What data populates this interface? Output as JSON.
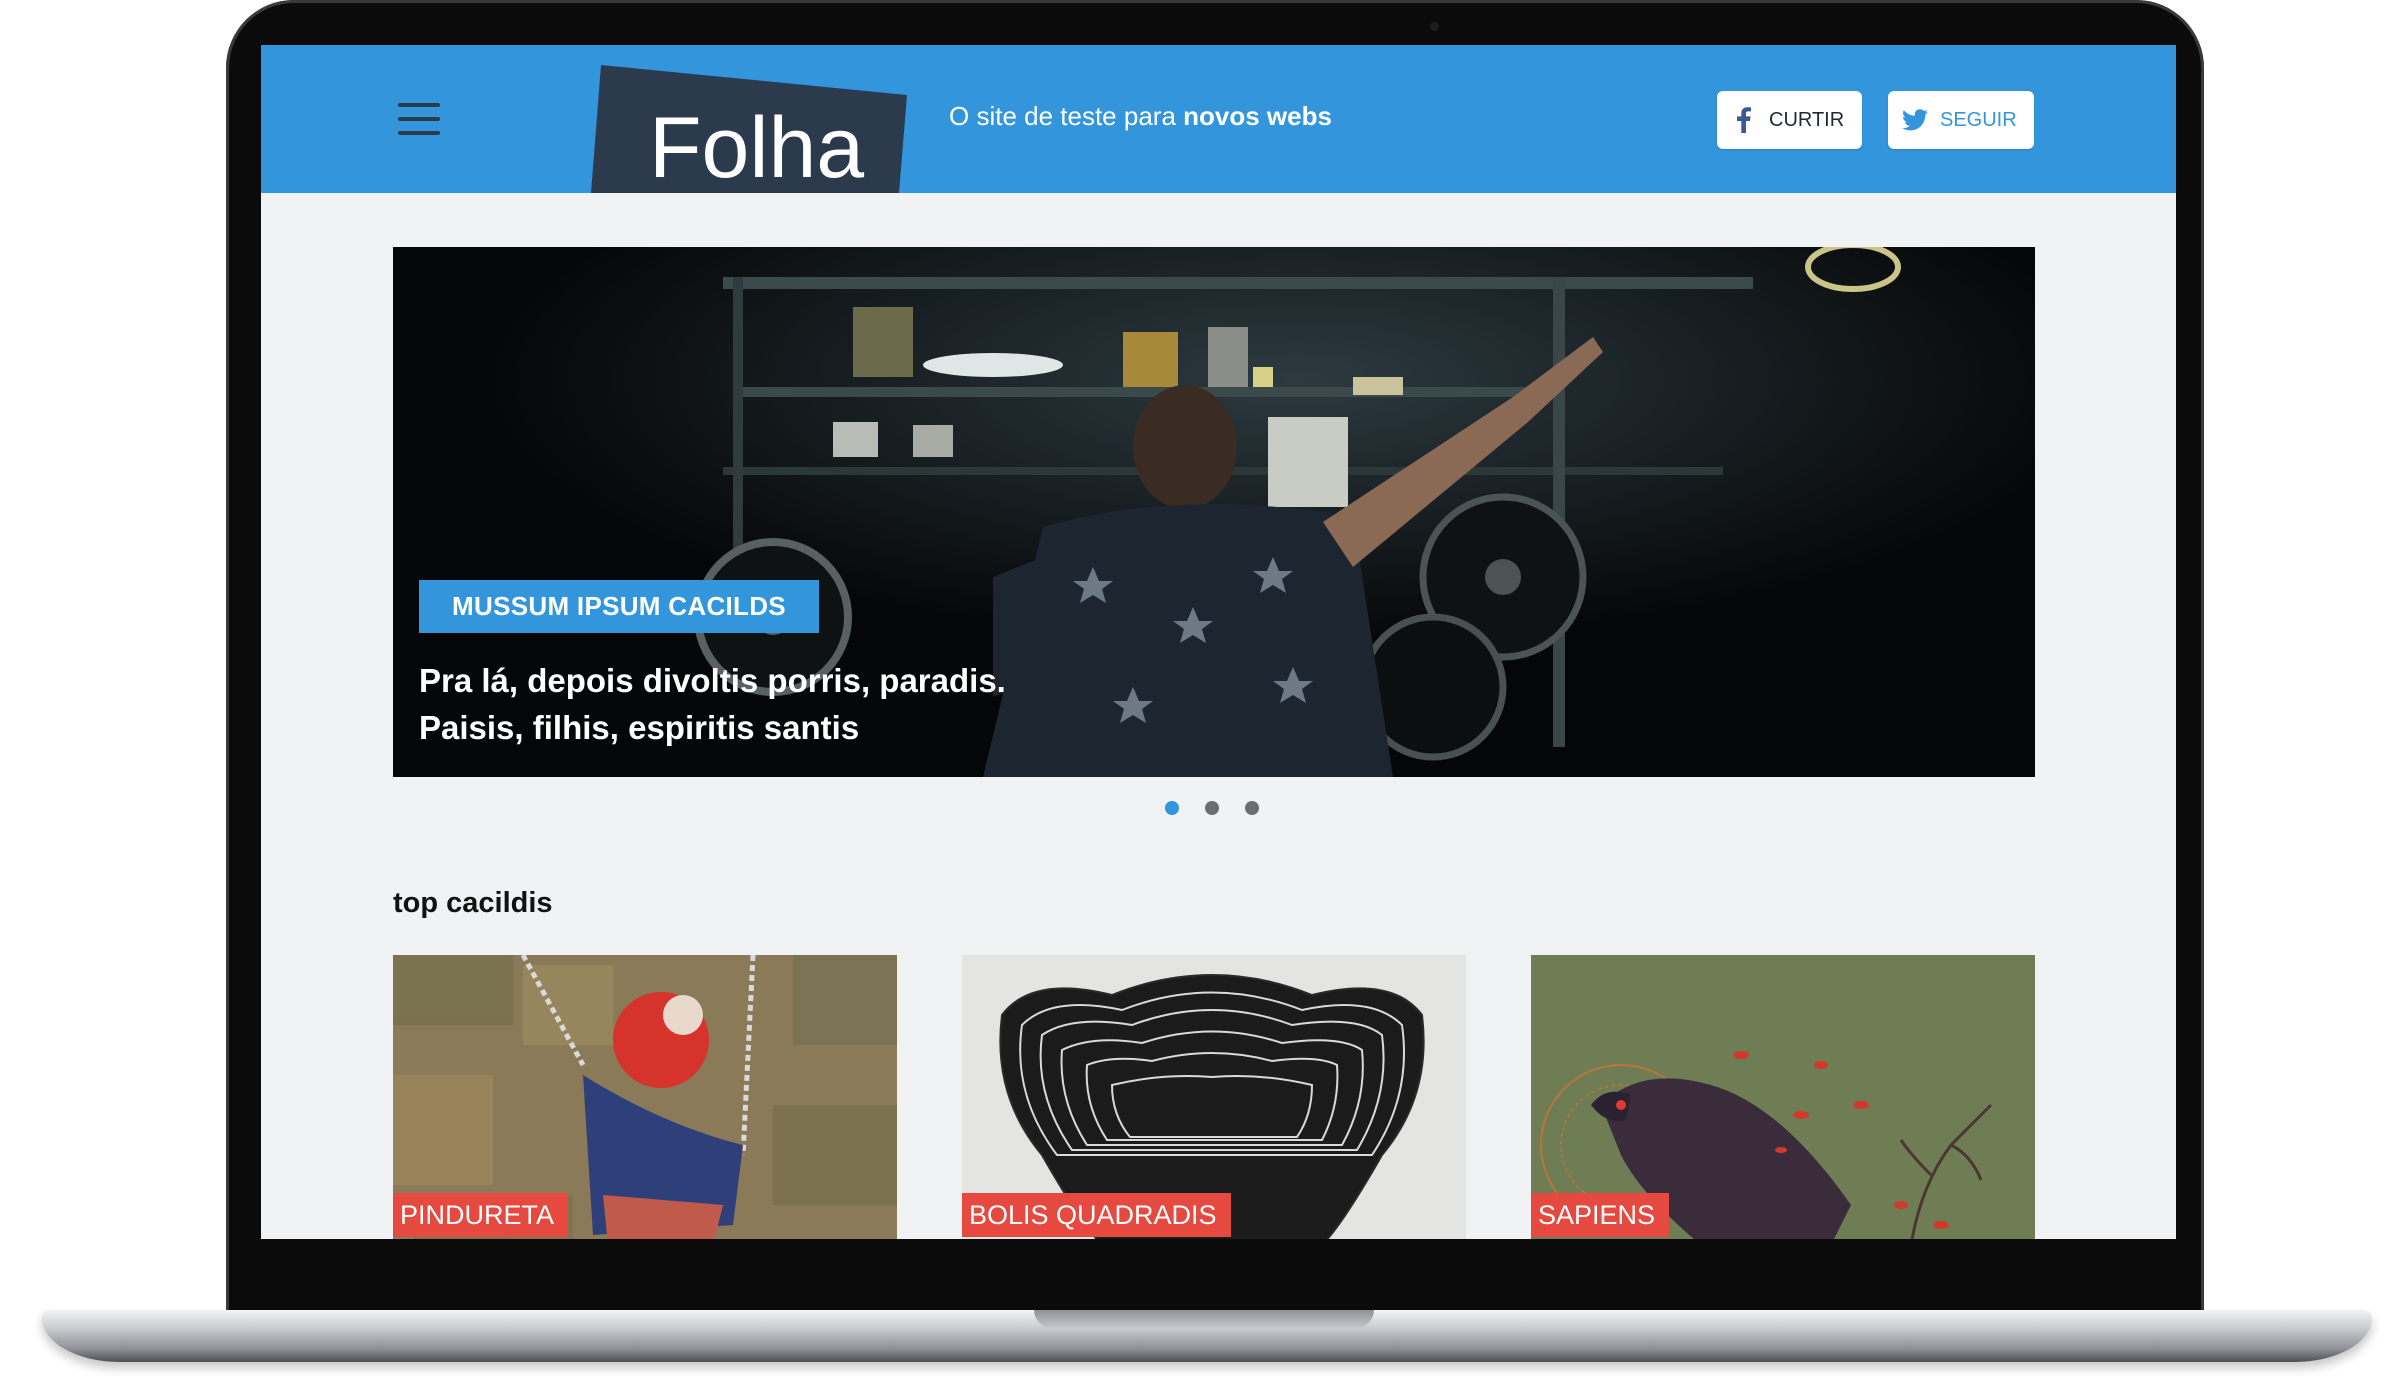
{
  "header": {
    "logo_text": "Folha",
    "tagline_prefix": "O site de teste para ",
    "tagline_bold": "novos webs",
    "buttons": {
      "curtir": "CURTIR",
      "seguir": "SEGUIR"
    }
  },
  "hero": {
    "tag": "MUSSUM IPSUM CACILDS",
    "title_line1": "Pra lá, depois divoltis porris, paradis.",
    "title_line2": "Paisis, filhis, espiritis santis"
  },
  "carousel": {
    "slide_count": 3,
    "active_index": 0
  },
  "section": {
    "title": "top cacildis",
    "cards": [
      {
        "label": "PINDURETA"
      },
      {
        "label": "BOLIS QUADRADIS"
      },
      {
        "label": "SAPIENS"
      }
    ]
  },
  "colors": {
    "header_blue": "#3396dc",
    "logo_navy": "#2b3a4d",
    "label_red": "#e5493f",
    "page_bg": "#f1f2f4"
  },
  "icons": [
    "hamburger-menu-icon",
    "facebook-icon",
    "twitter-icon"
  ]
}
